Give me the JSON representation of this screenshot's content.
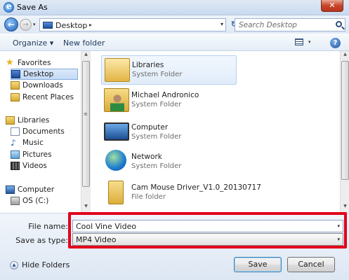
{
  "window": {
    "title": "Save As",
    "close_glyph": "✕"
  },
  "address": {
    "path": "Desktop",
    "separator": "▸",
    "dropdown": "▾"
  },
  "search": {
    "placeholder": "Search Desktop"
  },
  "toolbar": {
    "organize": "Organize ▾",
    "new_folder": "New folder",
    "help": "?"
  },
  "navpane": {
    "items": [
      {
        "label": "Favorites",
        "icon": "star-icon"
      },
      {
        "label": "Desktop",
        "icon": "desktop-icon",
        "selected": true
      },
      {
        "label": "Downloads",
        "icon": "downloads-icon"
      },
      {
        "label": "Recent Places",
        "icon": "recent-places-icon"
      },
      {
        "label": "Libraries",
        "icon": "libraries-icon"
      },
      {
        "label": "Documents",
        "icon": "documents-icon"
      },
      {
        "label": "Music",
        "icon": "music-icon"
      },
      {
        "label": "Pictures",
        "icon": "pictures-icon"
      },
      {
        "label": "Videos",
        "icon": "videos-icon"
      },
      {
        "label": "Computer",
        "icon": "computer-icon"
      },
      {
        "label": "OS (C:)",
        "icon": "drive-icon"
      }
    ]
  },
  "files": [
    {
      "name": "Libraries",
      "type": "System Folder",
      "icon": "libraries-folder-icon",
      "selected": true
    },
    {
      "name": "Michael Andronico",
      "type": "System Folder",
      "icon": "user-folder-icon"
    },
    {
      "name": "Computer",
      "type": "System Folder",
      "icon": "computer-icon"
    },
    {
      "name": "Network",
      "type": "System Folder",
      "icon": "network-icon"
    },
    {
      "name": "Cam Mouse Driver_V1.0_20130717",
      "type": "File folder",
      "icon": "zip-folder-icon"
    }
  ],
  "form": {
    "file_name_label": "File name:",
    "file_name_value": "Cool Vine Video",
    "save_as_type_label": "Save as type:",
    "save_as_type_value": "MP4 Video",
    "dropdown_arrow": "▾"
  },
  "buttons": {
    "hide_folders": "Hide Folders",
    "save": "Save",
    "cancel": "Cancel"
  },
  "colors": {
    "highlight": "#e3001b",
    "selection": "#c4dbf6"
  }
}
